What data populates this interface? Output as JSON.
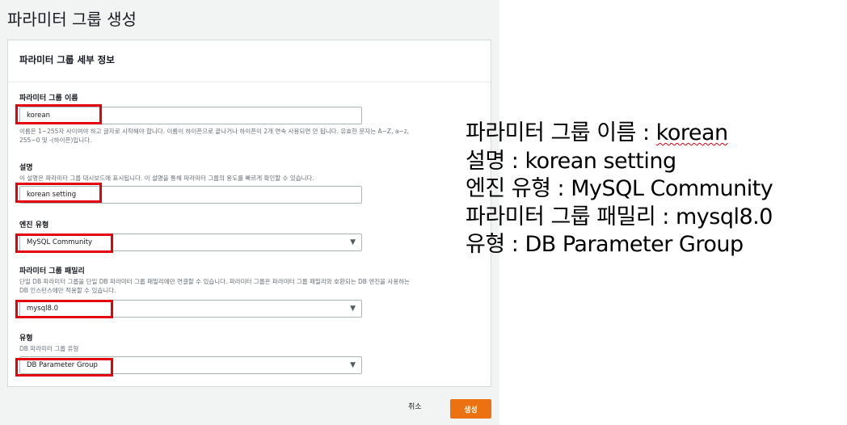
{
  "page": {
    "title": "파라미터 그룹 생성"
  },
  "panel": {
    "title": "파라미터 그룹 세부 정보"
  },
  "fields": {
    "name": {
      "label": "파라미터 그룹 이름",
      "value": "korean",
      "hint_line1": "이름은 1~255자 사이여야 하고 글자로 시작해야 합니다. 이름이 하이픈으로 끝나거나 하이픈이 2개 연속 사용되면 안 됩니다. 유효한 문자는 A~Z, a~z,",
      "hint_line2": "255~0 및 -(하이픈)입니다."
    },
    "description": {
      "label": "설명",
      "hint": "이 설명은 파라미터 그룹 대시보드에 표시됩니다. 이 설명을 통해 파라미터 그룹의 용도를 빠르게 확인할 수 있습니다.",
      "value": "korean setting"
    },
    "engine_type": {
      "label": "엔진 유형",
      "value": "MySQL Community"
    },
    "family": {
      "label": "파라미터 그룹 패밀리",
      "hint_line1": "단일 DB 파라미터 그룹을 단일 DB 파라미터 그룹 패밀리에만 연결할 수 있습니다. 파라미터 그룹은 파라미터 그룹 패밀리와 호환되는 DB 엔진을 사용하는",
      "hint_line2": "DB 인스턴스에만 적용할 수 있습니다.",
      "value": "mysql8.0"
    },
    "type": {
      "label": "유형",
      "hint": "DB 파라미터 그룹 유형",
      "value": "DB Parameter Group"
    }
  },
  "actions": {
    "cancel": "취소",
    "create": "생성"
  },
  "annotation": {
    "line1_label": "파라미터 그룹 이름 : ",
    "line1_value": "korean",
    "line2": "설명 : korean setting",
    "line3": "엔진 유형 : MySQL Community",
    "line4": "파라미터 그룹 패밀리 : mysql8.0",
    "line5": "유형 : DB Parameter Group"
  },
  "icons": {
    "dropdown": "caret-down-icon",
    "dropdown_glyph": "▼"
  },
  "colors": {
    "highlight": "#e3000f",
    "primary_button": "#ec7211",
    "console_bg": "#f2f3f3"
  }
}
